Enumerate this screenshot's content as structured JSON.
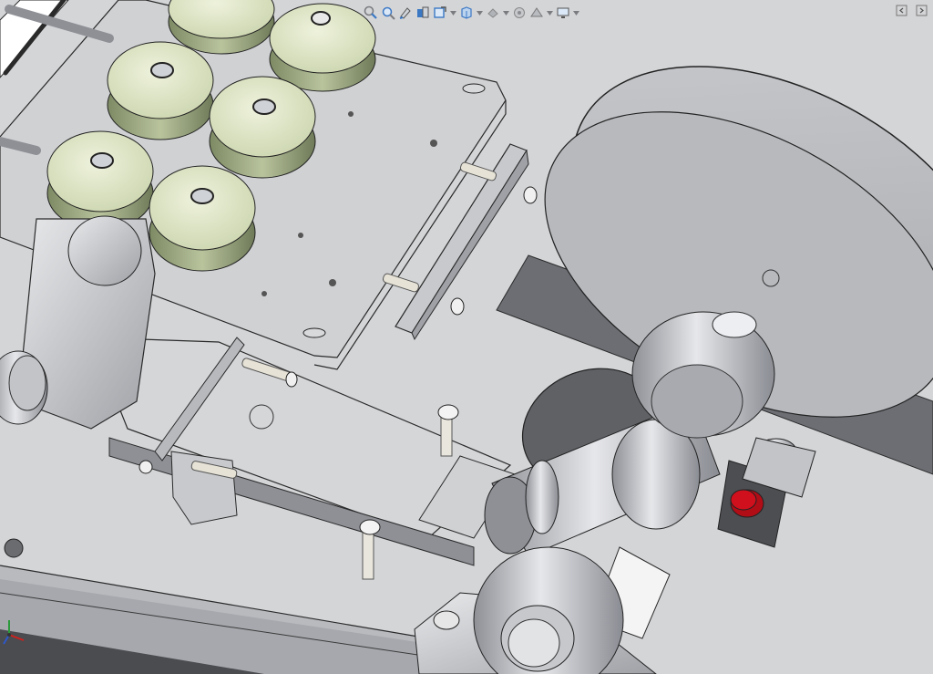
{
  "colors": {
    "background": "#d8d9db",
    "plate": "#cfd1d3",
    "plate_edge": "#9b9ea2",
    "line": "#2a2a2a",
    "roller_face": "#dfe6c9",
    "metal": "#c2c4c8",
    "metal_dark": "#8e9096",
    "disc": "#5a5c60",
    "knob_red": "#d0101c",
    "icon_blue": "#3b78c4",
    "icon_gray": "#7a7c80"
  },
  "heads_up_toolbar": {
    "items": [
      {
        "name": "zoom-to-fit-icon",
        "dropdown": false
      },
      {
        "name": "zoom-to-area-icon",
        "dropdown": false
      },
      {
        "name": "previous-view-icon",
        "dropdown": false
      },
      {
        "name": "section-view-icon",
        "dropdown": false
      },
      {
        "name": "dynamic-annotation-views-icon",
        "dropdown": false
      },
      {
        "name": "view-orientation-icon",
        "dropdown": true
      },
      {
        "name": "display-style-icon",
        "dropdown": true
      },
      {
        "name": "hide-show-items-icon",
        "dropdown": true
      },
      {
        "name": "edit-appearance-icon",
        "dropdown": false
      },
      {
        "name": "apply-scene-icon",
        "dropdown": true
      },
      {
        "name": "view-settings-icon",
        "dropdown": true
      }
    ]
  },
  "window_controls": [
    "restore-viewport-icon",
    "maximize-viewport-icon"
  ],
  "reference_triad": {
    "axes": [
      "x",
      "y",
      "z"
    ]
  }
}
